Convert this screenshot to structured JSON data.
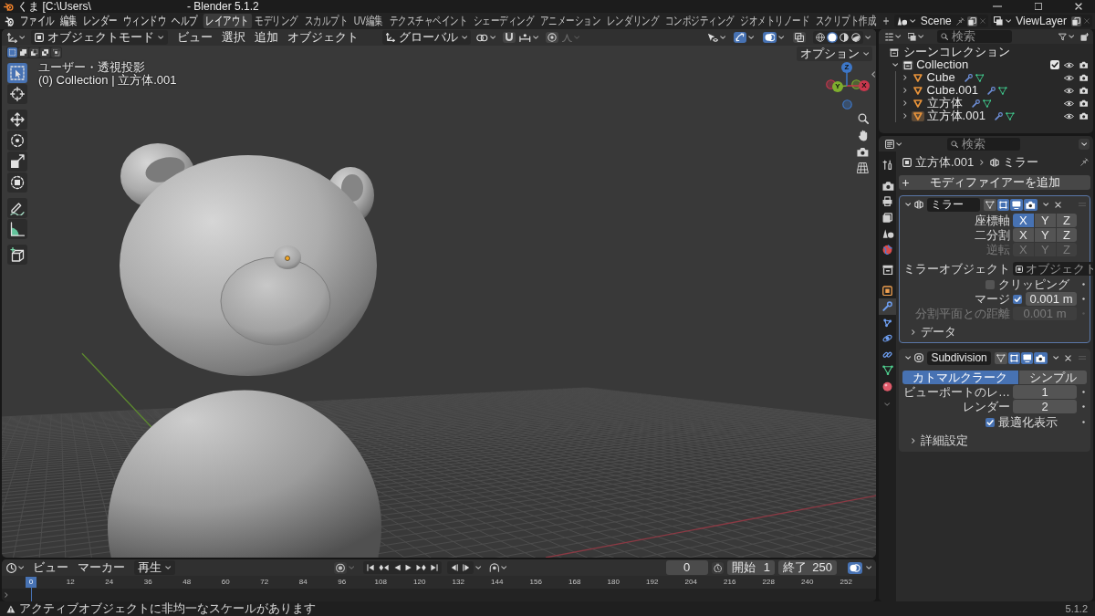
{
  "window": {
    "title": "くま [C:\\Users\\",
    "app_name": "- Blender 5.1.2"
  },
  "menu_bar": {
    "menus": [
      "ファイル",
      "編集",
      "レンダー",
      "ウィンドウ",
      "ヘルプ"
    ]
  },
  "workspace_tabs": [
    {
      "label": "レイアウト",
      "selected": true
    },
    {
      "label": "モデリング",
      "selected": false
    },
    {
      "label": "スカルプト",
      "selected": false
    },
    {
      "label": "UV編集",
      "selected": false
    },
    {
      "label": "テクスチャペイント",
      "selected": false
    },
    {
      "label": "シェーディング",
      "selected": false
    },
    {
      "label": "アニメーション",
      "selected": false
    },
    {
      "label": "レンダリング",
      "selected": false
    },
    {
      "label": "コンポジティング",
      "selected": false
    },
    {
      "label": "ジオメトリノード",
      "selected": false
    },
    {
      "label": "スクリプト作成",
      "selected": false
    }
  ],
  "scene": {
    "name": "Scene"
  },
  "view_layer": {
    "name": "ViewLayer"
  },
  "viewport": {
    "mode": "オブジェクトモード",
    "menus": [
      "ビュー",
      "選択",
      "追加",
      "オブジェクト"
    ],
    "orientation": "グローバル",
    "header_toggles": [
      {
        "kind": "snap",
        "on": false
      },
      {
        "kind": "proportional",
        "on": false
      },
      {
        "kind": "gizmos",
        "on": true
      },
      {
        "kind": "overlays",
        "on": true
      },
      {
        "kind": "xray",
        "on": false
      }
    ],
    "shading": [
      {
        "kind": "wireframe",
        "selected": false
      },
      {
        "kind": "solid",
        "selected": true
      },
      {
        "kind": "material",
        "selected": false
      },
      {
        "kind": "rendered",
        "selected": false
      }
    ],
    "select_modes": [
      {
        "kind": "set",
        "selected": true
      },
      {
        "kind": "extend",
        "selected": false
      },
      {
        "kind": "subtract",
        "selected": false
      },
      {
        "kind": "invert",
        "selected": false
      },
      {
        "kind": "intersect",
        "selected": false
      }
    ],
    "options": "オプション",
    "tools": [
      {
        "kind": "select_box",
        "selected": true
      },
      {
        "kind": "cursor",
        "selected": false
      },
      {
        "kind": "move",
        "selected": false
      },
      {
        "kind": "rotate",
        "selected": false
      },
      {
        "kind": "scale",
        "selected": false
      },
      {
        "kind": "transform",
        "selected": false
      },
      {
        "kind": "annotate",
        "selected": false
      },
      {
        "kind": "measure",
        "selected": false
      },
      {
        "kind": "add_cube",
        "selected": false
      }
    ],
    "view_name": "ユーザー・透視投影",
    "object_info": "(0) Collection | 立方体.001",
    "gizmo": [
      {
        "label": "X",
        "color": "#c8374d"
      },
      {
        "label": "Y",
        "color": "#7fae2e"
      },
      {
        "label": "Z",
        "color": "#3d77c8"
      }
    ]
  },
  "outliner": {
    "search": {
      "placeholder": "検索"
    },
    "tree": {
      "name": "シーンコレクション",
      "children": [
        {
          "name": "Collection",
          "expanded": true,
          "checked": true,
          "children": [
            {
              "name": "Cube",
              "expanded": false,
              "active": false
            },
            {
              "name": "Cube.001",
              "expanded": false,
              "active": false
            },
            {
              "name": "立方体",
              "expanded": false,
              "active": false
            },
            {
              "name": "立方体.001",
              "expanded": false,
              "active": true
            }
          ]
        }
      ]
    }
  },
  "properties": {
    "search": {
      "placeholder": "検索"
    },
    "tabs": [
      {
        "kind": "tool",
        "selected": false
      },
      {
        "kind": "render",
        "selected": false
      },
      {
        "kind": "output",
        "selected": false
      },
      {
        "kind": "view_layer",
        "selected": false
      },
      {
        "kind": "scene",
        "selected": false
      },
      {
        "kind": "world",
        "selected": false
      },
      {
        "kind": "collection",
        "selected": false
      },
      {
        "kind": "object",
        "selected": false
      },
      {
        "kind": "modifiers",
        "selected": true
      },
      {
        "kind": "particles",
        "selected": false
      },
      {
        "kind": "physics",
        "selected": false
      },
      {
        "kind": "constraints",
        "selected": false
      },
      {
        "kind": "data",
        "selected": false
      },
      {
        "kind": "material",
        "selected": false
      }
    ],
    "breadcrumb": [
      {
        "kind": "object",
        "label": "立方体.001"
      },
      {
        "kind": "mirror",
        "label": "ミラー"
      }
    ],
    "add_modifier": "モディファイアーを追加",
    "modifiers": [
      {
        "kind": "mirror",
        "name": "ミラー",
        "expanded": true,
        "active": true,
        "toggles": [
          {
            "kind": "on_cage",
            "on": false
          },
          {
            "kind": "edit_mode",
            "on": true
          },
          {
            "kind": "viewport",
            "on": true
          },
          {
            "kind": "render",
            "on": true
          }
        ],
        "rows": [
          {
            "kind": "axis_toggle",
            "label": "座標軸",
            "disabled": false,
            "options": [
              {
                "label": "X",
                "selected": true
              },
              {
                "label": "Y",
                "selected": false
              },
              {
                "label": "Z",
                "selected": false
              }
            ]
          },
          {
            "kind": "axis_toggle",
            "label": "二分割",
            "disabled": false,
            "options": [
              {
                "label": "X",
                "selected": false
              },
              {
                "label": "Y",
                "selected": false
              },
              {
                "label": "Z",
                "selected": false
              }
            ]
          },
          {
            "kind": "axis_toggle",
            "label": "逆転",
            "disabled": true,
            "options": [
              {
                "label": "X",
                "selected": false
              },
              {
                "label": "Y",
                "selected": false
              },
              {
                "label": "Z",
                "selected": false
              }
            ]
          },
          {
            "kind": "object_field",
            "label": "ミラーオブジェクト",
            "placeholder": "オブジェクト",
            "disabled": false
          },
          {
            "kind": "checkbox",
            "label": "クリッピング",
            "checked": false,
            "disabled": false
          },
          {
            "kind": "checkbox_value",
            "label": "マージ",
            "checked": true,
            "value": "0.001 m",
            "disabled": false
          },
          {
            "kind": "value",
            "label": "分割平面との距離",
            "value": "0.001 m",
            "disabled": true
          },
          {
            "kind": "subpanel",
            "label": "データ",
            "expanded": false,
            "disabled": false
          }
        ]
      },
      {
        "kind": "subdivision",
        "name": "Subdivision",
        "expanded": true,
        "active": false,
        "toggles": [
          {
            "kind": "on_cage",
            "on": false
          },
          {
            "kind": "edit_mode",
            "on": true
          },
          {
            "kind": "viewport",
            "on": true
          },
          {
            "kind": "render",
            "on": true
          }
        ],
        "rows": [
          {
            "kind": "segmented",
            "disabled": false,
            "options": [
              {
                "label": "カトマルクラーク",
                "selected": true
              },
              {
                "label": "シンプル",
                "selected": false
              }
            ]
          },
          {
            "kind": "value",
            "label": "ビューポートのレ…",
            "value": "1",
            "disabled": false
          },
          {
            "kind": "value",
            "label": "レンダー",
            "value": "2",
            "disabled": false
          },
          {
            "kind": "checkbox",
            "label": "最適化表示",
            "checked": true,
            "disabled": false
          },
          {
            "kind": "subpanel",
            "label": "詳細設定",
            "expanded": false,
            "disabled": false
          }
        ]
      }
    ]
  },
  "timeline": {
    "menus": [
      "ビュー",
      "マーカー"
    ],
    "playback": "再生",
    "toggles": [
      {
        "kind": "auto_keying",
        "on": false
      },
      {
        "kind": "preview_range",
        "on": false
      },
      {
        "kind": "overlays",
        "on": true
      }
    ],
    "current_frame": "0",
    "start": {
      "label": "開始",
      "value": "1"
    },
    "end": {
      "label": "終了",
      "value": "250"
    },
    "playhead": "0",
    "ruler": [
      "12",
      "24",
      "36",
      "48",
      "60",
      "72",
      "84",
      "96",
      "108",
      "120",
      "132",
      "144",
      "156",
      "168",
      "180",
      "192",
      "204",
      "216",
      "228",
      "240",
      "252"
    ]
  },
  "status_bar": {
    "message": "アクティブオブジェクトに非均一なスケールがあります",
    "version": "5.1.2"
  }
}
